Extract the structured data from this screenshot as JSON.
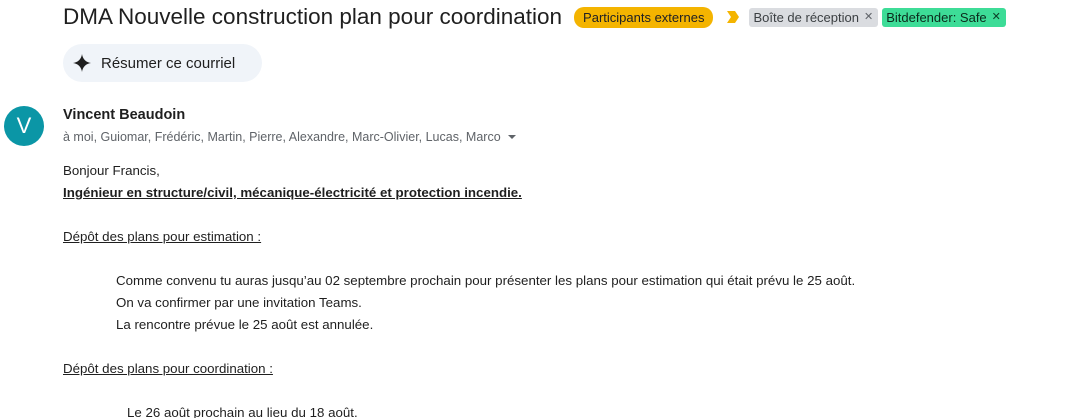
{
  "email": {
    "subject": "DMA Nouvelle construction plan pour coordination",
    "labels": {
      "external": "Participants externes",
      "inbox": "Boîte de réception",
      "bitdefender": "Bitdefender: Safe"
    },
    "summarize_label": "Résumer ce courriel",
    "sender": {
      "initial": "V",
      "name": "Vincent Beaudoin",
      "recipients": "à moi, Guiomar, Frédéric, Martin, Pierre, Alexandre, Marc-Olivier, Lucas, Marco"
    },
    "body": {
      "greeting": "Bonjour Francis,",
      "heading": "Ingénieur en structure/civil, mécanique-électricité et protection incendie.",
      "section1_title": "Dépôt des plans pour estimation :",
      "section1_lines": [
        "Comme convenu tu auras jusqu’au 02 septembre prochain pour présenter les plans pour estimation qui était prévu le 25 août.",
        "On va confirmer par une invitation Teams.",
        "La rencontre prévue le 25 août est annulée."
      ],
      "section2_title": "Dépôt des plans pour coordination :",
      "section2_lines": [
        "Le 26 août prochain au lieu du 18 août."
      ]
    }
  },
  "colors": {
    "external_label": "#f4b400",
    "inbox_chip": "#dadce0",
    "bitdefender_chip": "#3ddc97",
    "avatar": "#0b96a6",
    "summarize_bg": "#f0f4f9"
  },
  "icons": {
    "importance": "importance-marker-icon",
    "summarize": "sparkle-icon",
    "remove_label": "close-icon",
    "recipients_toggle": "caret-down-icon"
  }
}
